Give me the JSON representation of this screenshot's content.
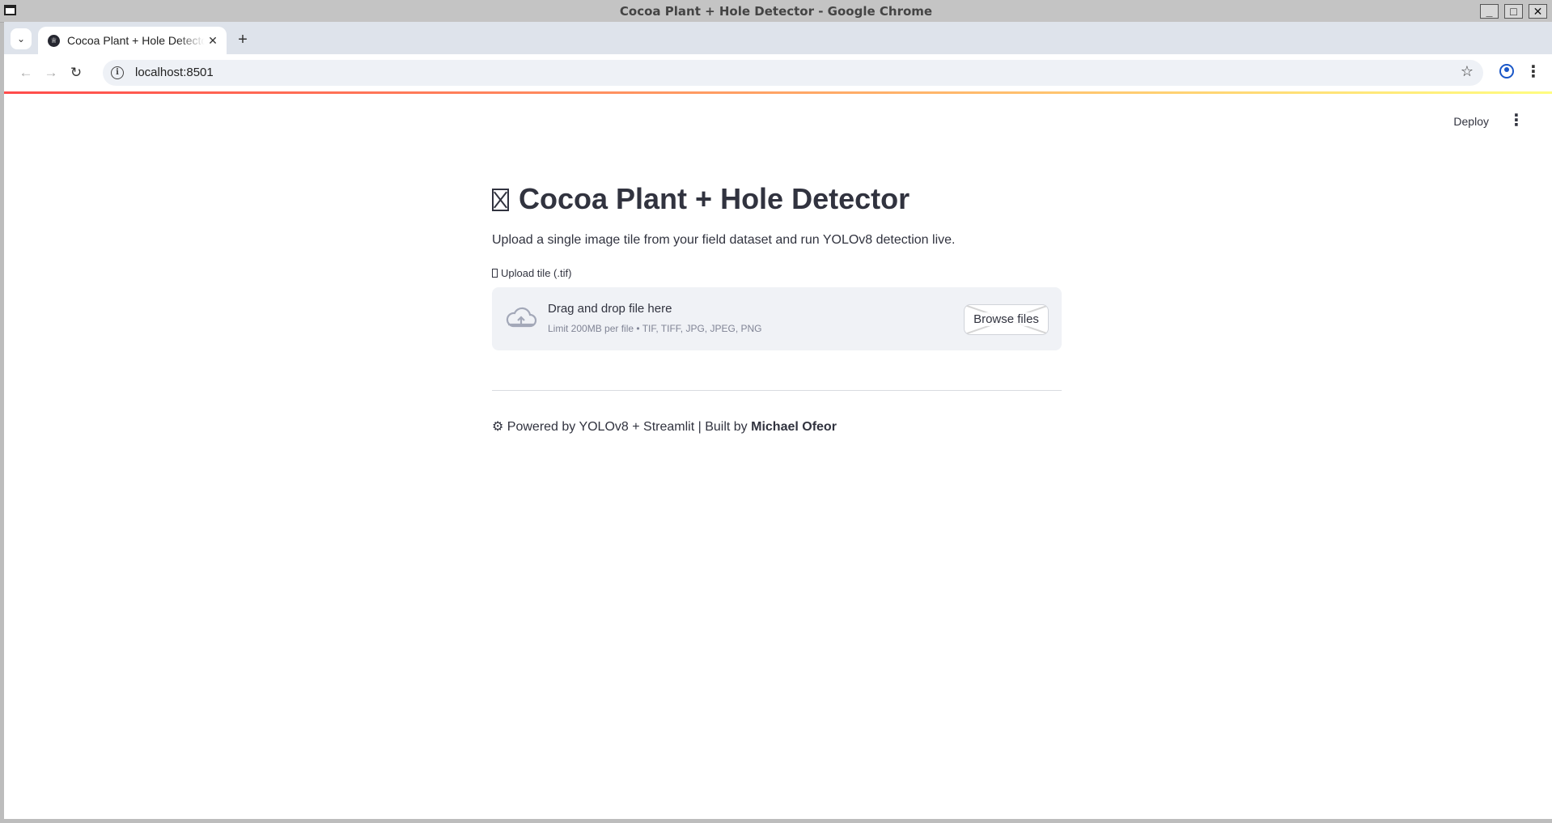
{
  "window": {
    "title": "Cocoa Plant + Hole Detector - Google Chrome",
    "minimize": "_",
    "maximize": "□",
    "close": "✕"
  },
  "browser": {
    "tab_title": "Cocoa Plant + Hole Detector",
    "tab_close": "✕",
    "new_tab": "+",
    "url": "localhost:8501",
    "icons": {
      "back": "arrow-left-icon",
      "forward": "arrow-right-icon",
      "reload": "reload-icon",
      "bookmark": "star-icon",
      "profile": "account-circle-icon",
      "menu": "kebab-menu-icon"
    }
  },
  "app": {
    "deploy_label": "Deploy",
    "title": "Cocoa Plant + Hole Detector",
    "subtitle": "Upload a single image tile from your field dataset and run YOLOv8 detection live.",
    "uploader": {
      "label": "Upload tile (.tif)",
      "drop_title": "Drag and drop file here",
      "drop_limits": "Limit 200MB per file • TIF, TIFF, JPG, JPEG, PNG",
      "browse_label": "Browse files"
    },
    "footer": {
      "prefix": "⚙ Powered by YOLOv8 + Streamlit | Built by",
      "author": "Michael Ofeor"
    },
    "colors": {
      "accent_start": "#ff4b4b",
      "accent_end": "#fffd80",
      "text": "#31333f",
      "dropzone_bg": "#f0f2f6"
    }
  }
}
